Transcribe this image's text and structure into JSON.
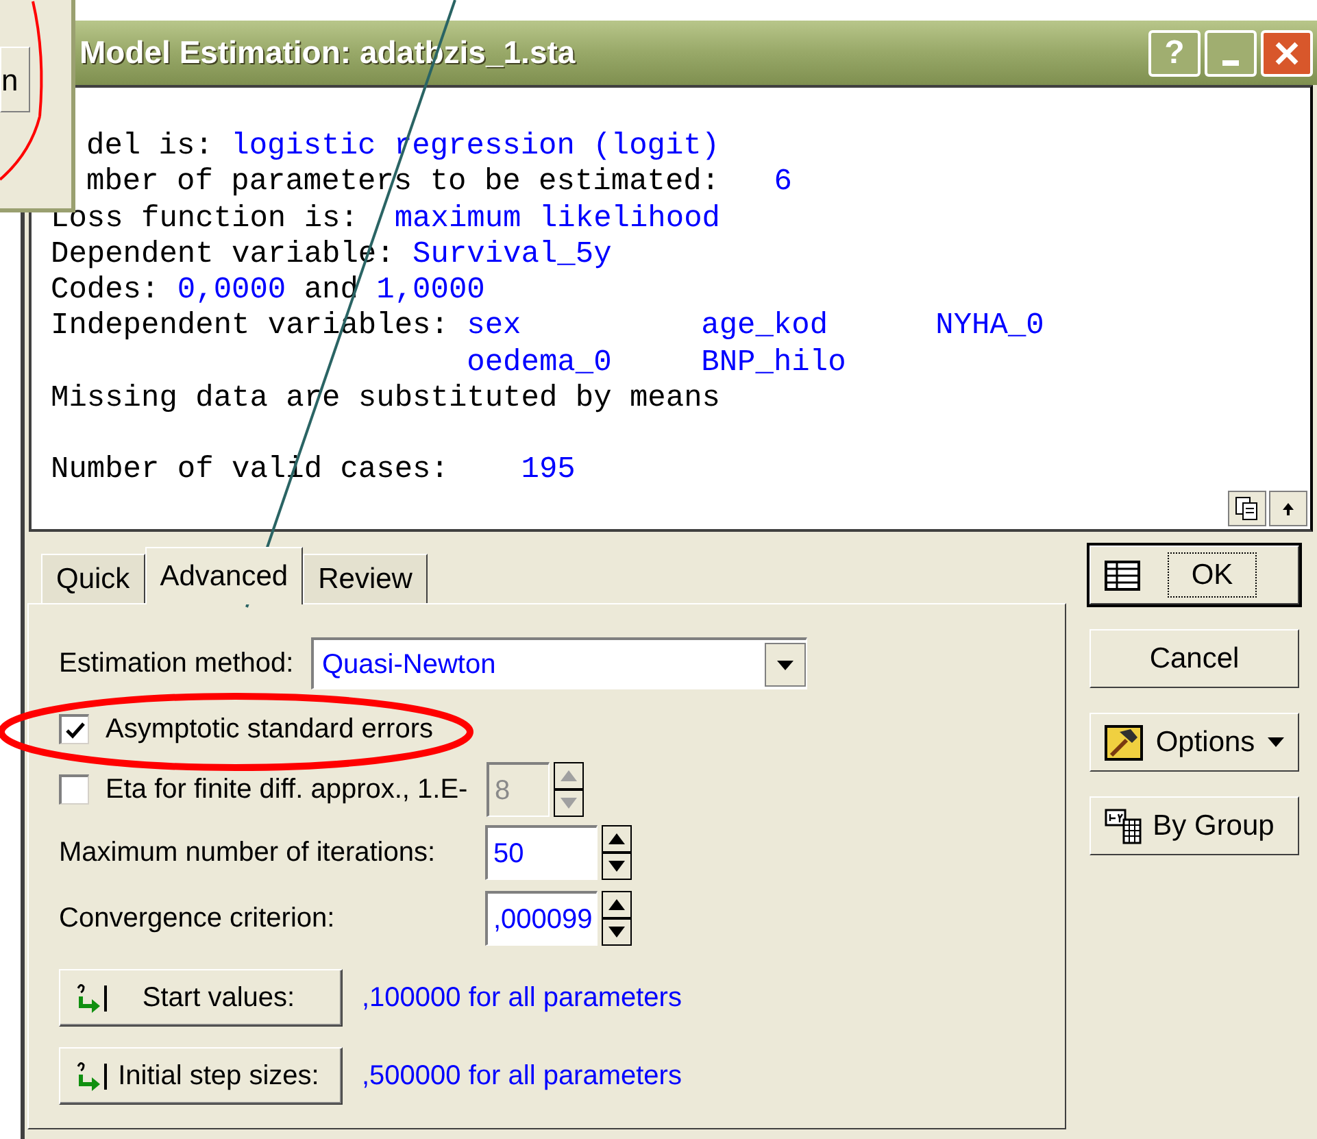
{
  "background_window": {
    "button_text": "n"
  },
  "window": {
    "title": "Model Estimation: adatbzis_1.sta",
    "buttons": [
      {
        "kind": "help",
        "label": "?"
      },
      {
        "kind": "minimize"
      },
      {
        "kind": "close"
      }
    ]
  },
  "output": {
    "lines": [
      [
        {
          "kind": "covered",
          "text": "del is: "
        },
        {
          "kind": "value",
          "text": "logistic regression (logit)"
        }
      ],
      [
        {
          "kind": "covered",
          "text": "mber of parameters to be estimated:   "
        },
        {
          "kind": "value",
          "text": "6"
        }
      ],
      [
        {
          "kind": "label",
          "text": "Loss function is:  "
        },
        {
          "kind": "value",
          "text": "maximum likelihood"
        }
      ],
      [
        {
          "kind": "label",
          "text": "Dependent variable: "
        },
        {
          "kind": "value",
          "text": "Survival_5y"
        }
      ],
      [
        {
          "kind": "label",
          "text": "Codes: "
        },
        {
          "kind": "value",
          "text": "0,0000"
        },
        {
          "kind": "label",
          "text": " and "
        },
        {
          "kind": "value",
          "text": "1,0000"
        }
      ]
    ],
    "independent_variables": {
      "label": "Independent variables: ",
      "values": [
        "sex",
        "age_kod",
        "NYHA_0",
        "oedema_0",
        "BNP_hilo"
      ]
    },
    "missing": "Missing data are substituted by means",
    "valid_cases": {
      "label": "Number of valid cases:    ",
      "value": "195"
    }
  },
  "tabs": [
    {
      "label": "Quick",
      "selected": false
    },
    {
      "label": "Advanced",
      "selected": true
    },
    {
      "label": "Review",
      "selected": false
    }
  ],
  "form": [
    {
      "kind": "select",
      "label": "Estimation method:",
      "value": "Quasi-Newton"
    },
    {
      "kind": "checkbox",
      "label": "Asymptotic standard errors",
      "checked": true
    },
    {
      "kind": "checkbox",
      "label": "Eta for finite diff. approx., 1.E-",
      "checked": false,
      "spin": {
        "value": "8",
        "disabled": true
      }
    },
    {
      "kind": "spin",
      "label": "Maximum number of iterations:",
      "value": "50"
    },
    {
      "kind": "spin",
      "label": "Convergence criterion:",
      "value": ",000099"
    },
    {
      "kind": "button",
      "label": "Start values:",
      "note": ",100000 for all parameters"
    },
    {
      "kind": "button",
      "label": "Initial step sizes:",
      "note": ",500000 for all parameters"
    }
  ],
  "side_buttons": [
    {
      "kind": "default",
      "label": "OK"
    },
    {
      "kind": "plain",
      "label": "Cancel"
    },
    {
      "kind": "menu",
      "label": "Options"
    },
    {
      "kind": "group",
      "label": "By Group"
    }
  ]
}
